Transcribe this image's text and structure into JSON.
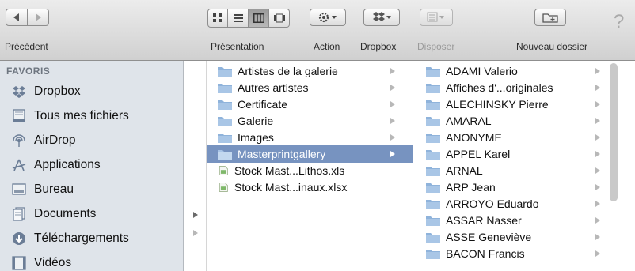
{
  "toolbar": {
    "back_label": "Précédent",
    "view_label": "Présentation",
    "action_label": "Action",
    "dropbox_label": "Dropbox",
    "arrange_label": "Disposer",
    "new_folder_label": "Nouveau dossier",
    "help_glyph": "?"
  },
  "sidebar": {
    "heading": "FAVORIS",
    "items": [
      {
        "label": "Dropbox",
        "icon": "dropbox-icon"
      },
      {
        "label": "Tous mes fichiers",
        "icon": "all-files-icon"
      },
      {
        "label": "AirDrop",
        "icon": "airdrop-icon"
      },
      {
        "label": "Applications",
        "icon": "applications-icon"
      },
      {
        "label": "Bureau",
        "icon": "desktop-icon"
      },
      {
        "label": "Documents",
        "icon": "documents-icon"
      },
      {
        "label": "Téléchargements",
        "icon": "downloads-icon"
      },
      {
        "label": "Vidéos",
        "icon": "movies-icon"
      }
    ]
  },
  "column3": {
    "items": [
      {
        "label": "Artistes de la galerie",
        "type": "folder"
      },
      {
        "label": "Autres artistes",
        "type": "folder"
      },
      {
        "label": "Certificate",
        "type": "folder"
      },
      {
        "label": "Galerie",
        "type": "folder"
      },
      {
        "label": "Images",
        "type": "folder"
      },
      {
        "label": "Masterprintgallery",
        "type": "folder",
        "selected": true
      },
      {
        "label": "Stock Mast...Lithos.xls",
        "type": "file"
      },
      {
        "label": "Stock Mast...inaux.xlsx",
        "type": "file"
      }
    ]
  },
  "column4": {
    "items": [
      {
        "label": "ADAMI Valerio"
      },
      {
        "label": "Affiches d'...originales"
      },
      {
        "label": "ALECHINSKY Pierre"
      },
      {
        "label": "AMARAL"
      },
      {
        "label": "ANONYME"
      },
      {
        "label": "APPEL Karel"
      },
      {
        "label": "ARNAL"
      },
      {
        "label": "ARP Jean"
      },
      {
        "label": "ARROYO Eduardo"
      },
      {
        "label": "ASSAR Nasser"
      },
      {
        "label": "ASSE Geneviève"
      },
      {
        "label": "BACON Francis"
      }
    ]
  },
  "colors": {
    "selection": "#7793c0",
    "folder": "#8fb3db",
    "sidebar_bg": "#dfe4ea"
  }
}
